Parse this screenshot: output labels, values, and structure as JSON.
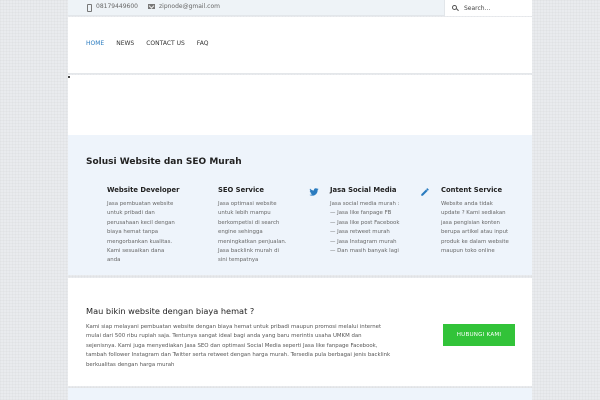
{
  "topbar": {
    "phone": "08179449600",
    "email": "zipnode@gmail.com",
    "search_placeholder": "Search..."
  },
  "nav": {
    "items": [
      {
        "label": "HOME",
        "active": true
      },
      {
        "label": "NEWS"
      },
      {
        "label": "CONTACT US"
      },
      {
        "label": "FAQ"
      }
    ]
  },
  "services": {
    "heading": "Solusi Website dan SEO Murah",
    "items": [
      {
        "title": "Website Developer",
        "icon": "none",
        "description": "Jasa pembuatan website\nuntuk pribadi dan\nperusahaan kecil dengan\nbiaya hemat tanpa\nmengorbankan kualitas.\nKami sesuaikan dana\nanda"
      },
      {
        "title": "SEO Service",
        "icon": "none",
        "description": "Jasa optimasi website\nuntuk lebih mampu\nberkompetisi di search\nengine sehingga\nmeningkatkan penjualan.\nJasa backlink murah di\nsini tempatnya"
      },
      {
        "title": "Jasa Social Media",
        "icon": "twitter-bird-icon",
        "description": "Jasa social media murah :\n— Jasa like fanpage FB\n— Jasa like post Facebook\n— Jasa retweet murah\n— Jasa Instagram murah\n— Dan masih banyak lagi"
      },
      {
        "title": "Content Service",
        "icon": "pencil-icon",
        "description": "Website anda tidak\nupdate ? Kami sediakan\njasa pengisian konten\nberupa artikel atau input\nproduk ke dalam website\nmaupun toko online"
      }
    ]
  },
  "cta": {
    "heading": "Mau bikin website dengan biaya hemat ?",
    "body": "Kami siap melayani pembuatan website dengan biaya hemat untuk pribadi maupun promosi melalui internet mulai dari 500 ribu rupiah saja. Tentunya sangat ideal bagi anda yang baru merintis usaha UMKM dan sejenisnya. Kami juga menyediakan Jasa SEO dan optimasi Social Media seperti Jasa like fanpage Facebook, tambah follower Instagram dan Twitter serta retweet  dengan harga murah. Tersedia pula berbagai jenis backlink berkualitas dengan harga murah",
    "button_label": "HUBUNGI KAMI",
    "button_color": "#32c339"
  },
  "colors": {
    "accent": "#2a7bbf",
    "section_bg": "#eef4fb"
  }
}
